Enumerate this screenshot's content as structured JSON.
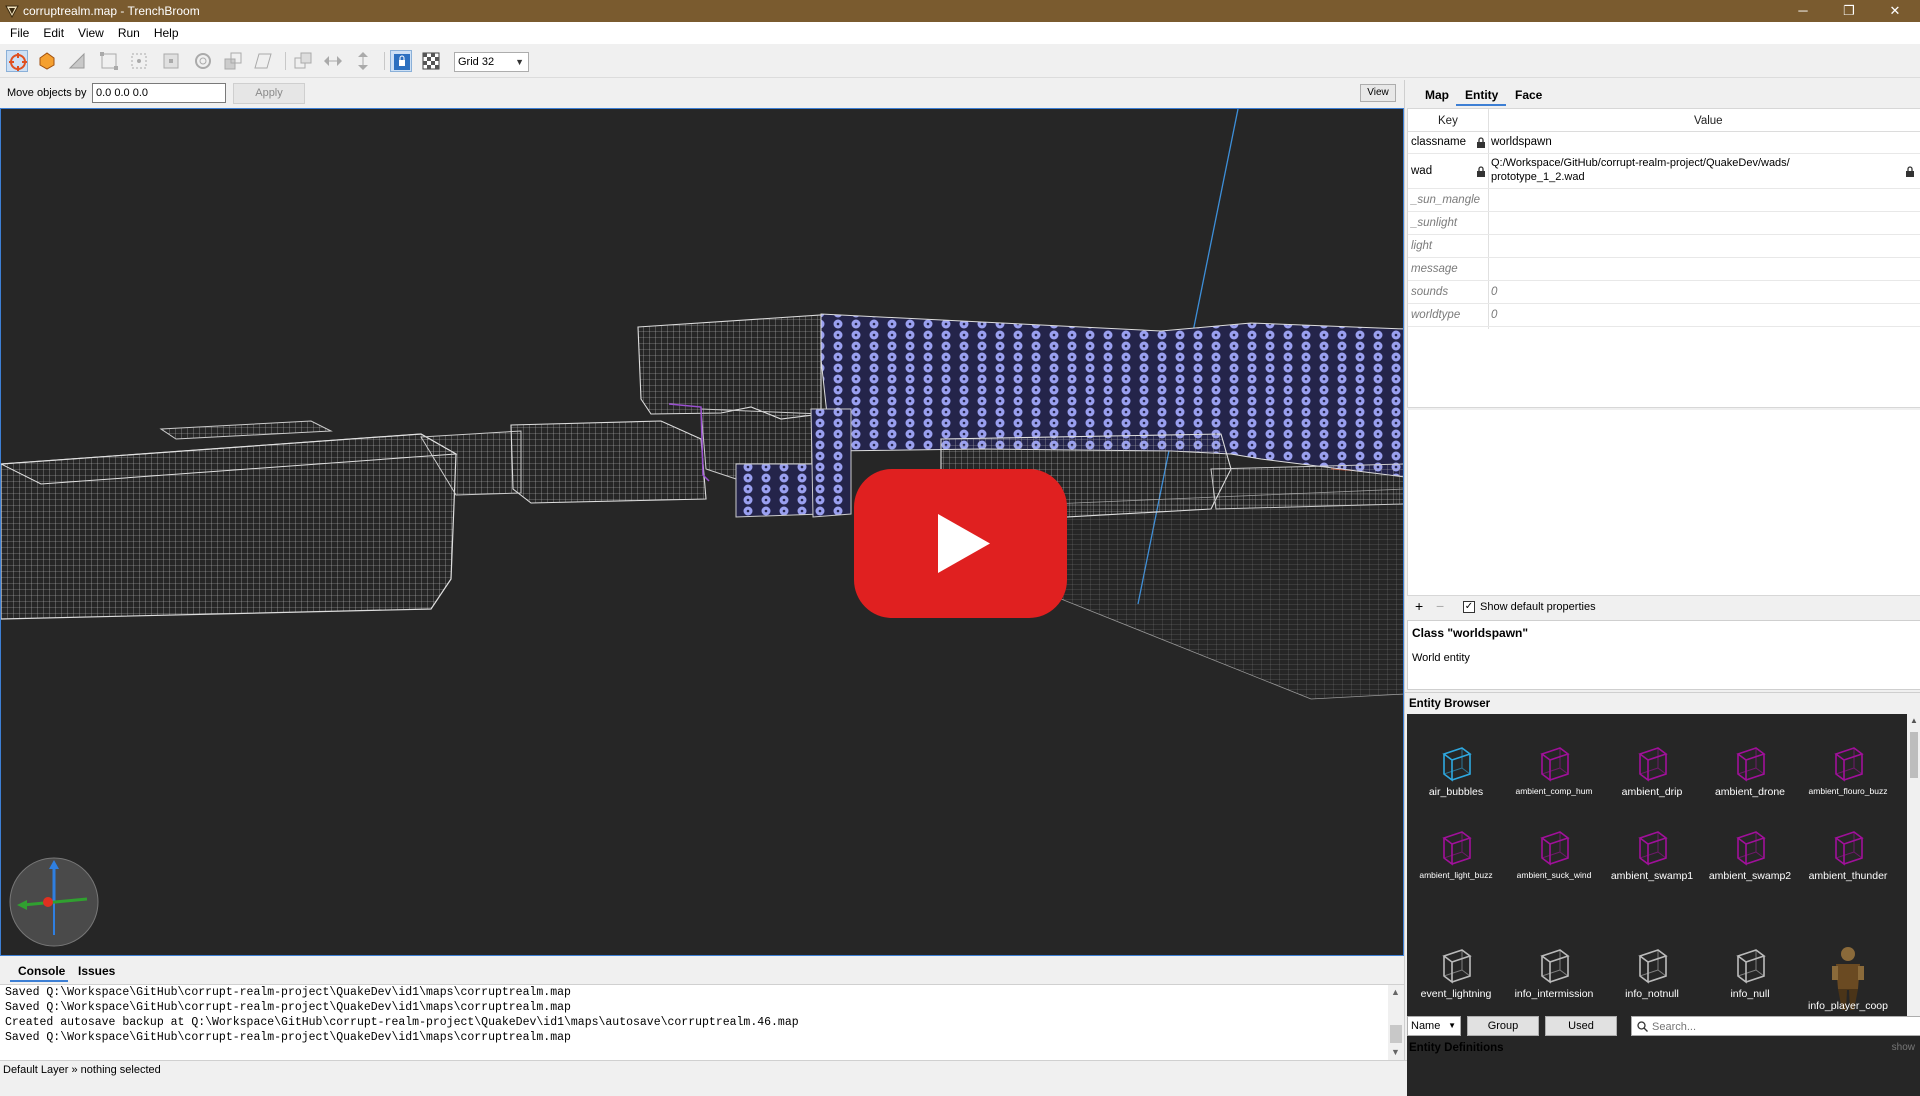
{
  "window": {
    "title": "corruptrealm.map - TrenchBroom",
    "controls": {
      "minimize": "─",
      "maximize": "❐",
      "close": "✕"
    }
  },
  "menu": {
    "items": [
      "File",
      "Edit",
      "View",
      "Run",
      "Help"
    ]
  },
  "toolbar": {
    "tools": [
      "select-tool",
      "brush-tool",
      "clip-tool",
      "vertex-tool",
      "edge-tool",
      "face-tool",
      "rotate-tool",
      "scale-tool",
      "shear-tool"
    ],
    "grid_value": "Grid 32"
  },
  "move_bar": {
    "label": "Move objects by",
    "value": "0.0 0.0 0.0",
    "apply_label": "Apply",
    "view_label": "View"
  },
  "viewport": {
    "wire_color": "#c8c8c8",
    "texture_color": "#9aa0f0",
    "axis_color": "#3d8fd9",
    "play_color": "#e02020"
  },
  "inspector": {
    "tabs": [
      "Map",
      "Entity",
      "Face"
    ],
    "active_tab": "Entity",
    "columns": {
      "key": "Key",
      "value": "Value"
    },
    "properties": [
      {
        "key": "classname",
        "value": "worldspawn",
        "locked": true,
        "default": false
      },
      {
        "key": "wad",
        "value": "Q:/Workspace/GitHub/corrupt-realm-project/QuakeDev/wads/",
        "value2": "prototype_1_2.wad",
        "locked": true,
        "default": false
      },
      {
        "key": "_sun_mangle",
        "value": "",
        "default": true
      },
      {
        "key": "_sunlight",
        "value": "",
        "default": true
      },
      {
        "key": "light",
        "value": "",
        "default": true
      },
      {
        "key": "message",
        "value": "",
        "default": true
      },
      {
        "key": "sounds",
        "value": "0",
        "default": true
      },
      {
        "key": "worldtype",
        "value": "0",
        "default": true
      }
    ],
    "add_label": "+",
    "remove_label": "−",
    "show_defaults_label": "Show default properties",
    "show_defaults_checked": true,
    "class_title": "Class \"worldspawn\"",
    "class_desc": "World entity"
  },
  "entity_browser": {
    "title": "Entity Browser",
    "entities": [
      {
        "name": "air_bubbles",
        "color": "#2ea8e0",
        "small": false
      },
      {
        "name": "ambient_comp_hum",
        "color": "#a0109a",
        "small": true
      },
      {
        "name": "ambient_drip",
        "color": "#a0109a",
        "small": false
      },
      {
        "name": "ambient_drone",
        "color": "#a0109a",
        "small": false
      },
      {
        "name": "ambient_flouro_buzz",
        "color": "#a0109a",
        "small": true
      },
      {
        "name": "ambient_light_buzz",
        "color": "#a0109a",
        "small": true
      },
      {
        "name": "ambient_suck_wind",
        "color": "#a0109a",
        "small": true
      },
      {
        "name": "ambient_swamp1",
        "color": "#a0109a",
        "small": false
      },
      {
        "name": "ambient_swamp2",
        "color": "#a0109a",
        "small": false
      },
      {
        "name": "ambient_thunder",
        "color": "#a0109a",
        "small": false
      },
      {
        "name": "event_lightning",
        "color": "#bbbbbb",
        "small": false
      },
      {
        "name": "info_intermission",
        "color": "#bbbbbb",
        "small": false
      },
      {
        "name": "info_notnull",
        "color": "#bbbbbb",
        "small": false
      },
      {
        "name": "info_null",
        "color": "#bbbbbb",
        "small": false
      },
      {
        "name": "info_player_coop",
        "color": "#8a6a3a",
        "small": false
      }
    ],
    "sort_value": "Name",
    "group_label": "Group",
    "used_label": "Used",
    "search_placeholder": "Search..."
  },
  "entity_definitions": {
    "title": "Entity Definitions",
    "toggle": "show"
  },
  "console": {
    "tabs": [
      "Console",
      "Issues"
    ],
    "lines": [
      "Saved Q:\\Workspace\\GitHub\\corrupt-realm-project\\QuakeDev\\id1\\maps\\corruptrealm.map",
      "Saved Q:\\Workspace\\GitHub\\corrupt-realm-project\\QuakeDev\\id1\\maps\\corruptrealm.map",
      "Created autosave backup at Q:\\Workspace\\GitHub\\corrupt-realm-project\\QuakeDev\\id1\\maps\\autosave\\corruptrealm.46.map",
      "Saved Q:\\Workspace\\GitHub\\corrupt-realm-project\\QuakeDev\\id1\\maps\\corruptrealm.map"
    ]
  },
  "status": {
    "text": "Default Layer » nothing selected"
  }
}
